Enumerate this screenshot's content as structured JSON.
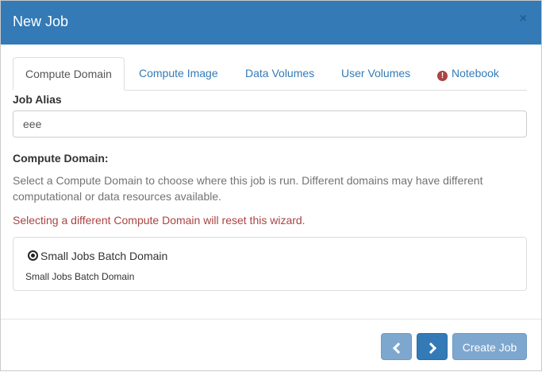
{
  "dialog": {
    "title": "New Job",
    "close_glyph": "×"
  },
  "tabs": [
    {
      "label": "Compute Domain",
      "active": true
    },
    {
      "label": "Compute Image"
    },
    {
      "label": "Data Volumes"
    },
    {
      "label": "User Volumes"
    },
    {
      "label": "Notebook",
      "icon": "exclamation-circle-icon",
      "icon_glyph": "!"
    }
  ],
  "job_alias": {
    "label": "Job Alias",
    "value": "eee"
  },
  "compute_domain": {
    "heading": "Compute Domain:",
    "help": "Select a Compute Domain to choose where this job is run. Different domains may have different computational or data resources available.",
    "warning": "Selecting a different Compute Domain will reset this wizard.",
    "selected": {
      "name": "Small Jobs Batch Domain",
      "description": "Small Jobs Batch Domain"
    }
  },
  "footer": {
    "create_label": "Create Job"
  },
  "colors": {
    "primary": "#337ab7",
    "primary_disabled": "#7da7cf",
    "danger": "#a94442"
  }
}
